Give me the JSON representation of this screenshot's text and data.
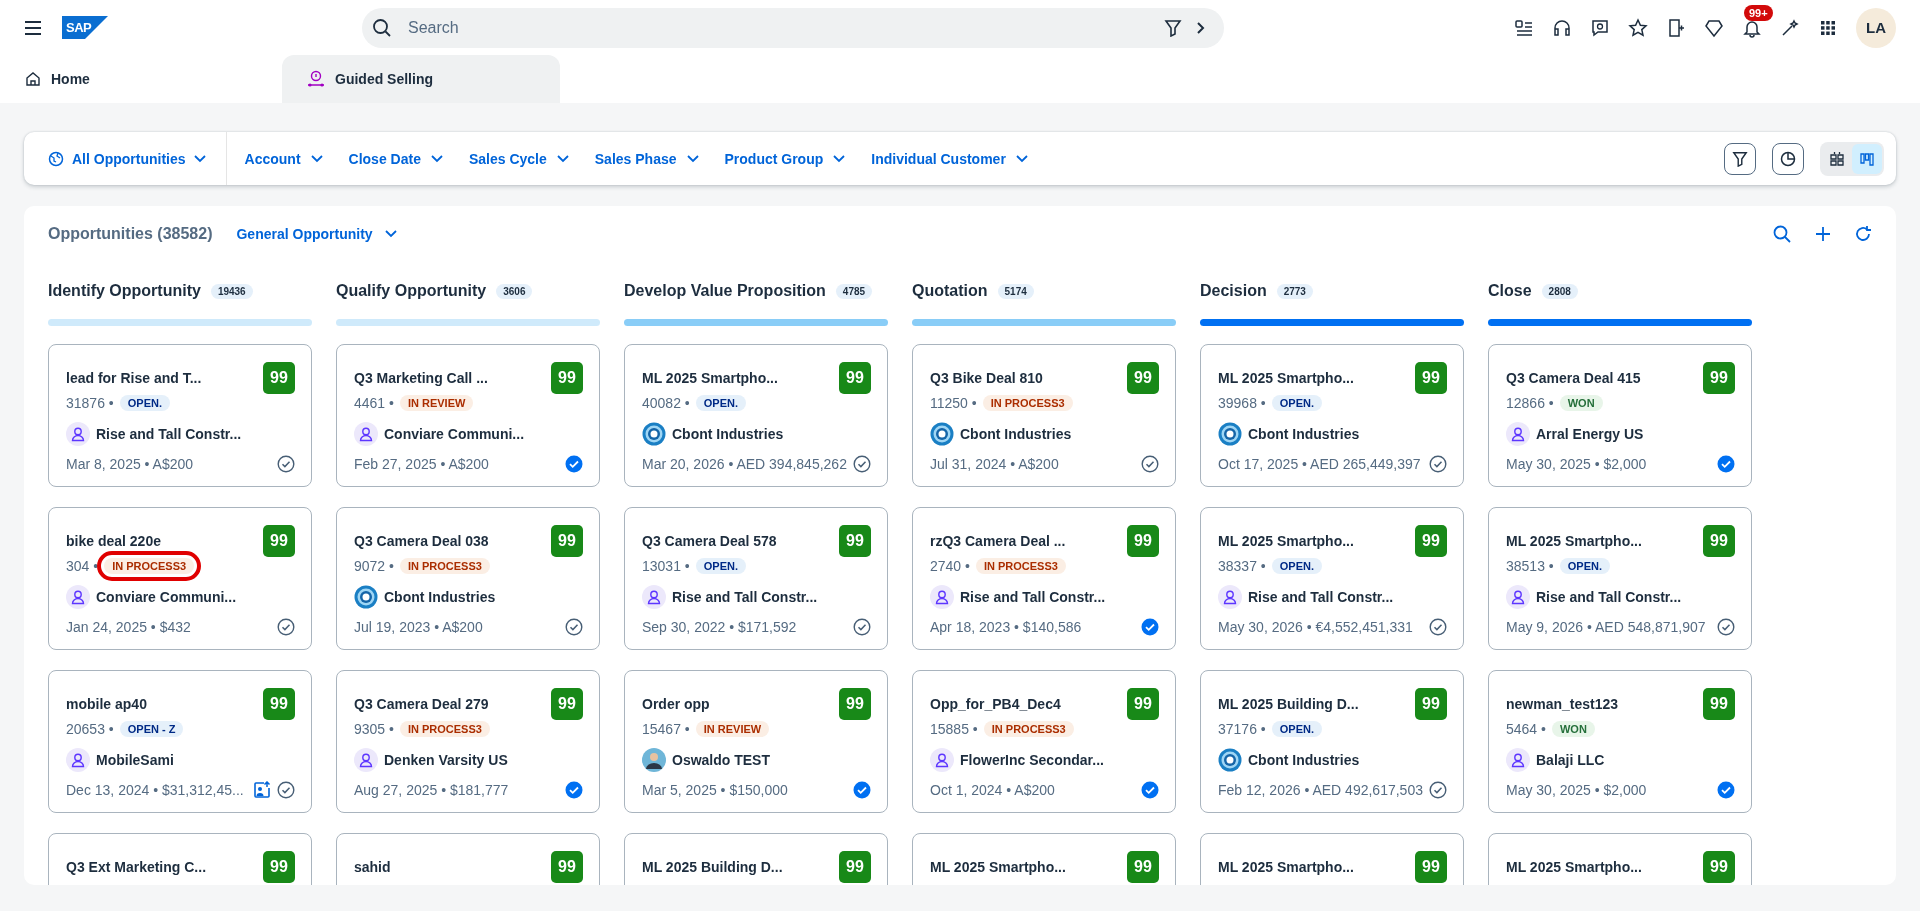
{
  "shell": {
    "logo_text": "SAP",
    "search_placeholder": "Search",
    "notification_count": "99+",
    "avatar_initials": "LA"
  },
  "tabs": [
    {
      "label": "Home",
      "selected": false
    },
    {
      "label": "Guided Selling",
      "selected": true
    }
  ],
  "filter_bar": {
    "variant": "All Opportunities",
    "filters": [
      "Account",
      "Close Date",
      "Sales Cycle",
      "Sales Phase",
      "Product Group",
      "Individual Customer"
    ],
    "view_toggle": [
      {
        "kind": "cards",
        "selected": false
      },
      {
        "kind": "kanban",
        "selected": true
      }
    ]
  },
  "board": {
    "title": "Opportunities (38582)",
    "type_selector": "General Opportunity",
    "columns": [
      {
        "name": "Identify Opportunity",
        "count": "19436",
        "color": "#cfeafb",
        "cards": [
          {
            "title": "lead for Rise and T...",
            "score": "99",
            "number": "31876 •",
            "status": {
              "label": "OPEN.",
              "kind": "info",
              "highlighted": false
            },
            "account": {
              "name": "Rise and Tall Constr...",
              "kind": "person"
            },
            "date_amount": "Mar 8, 2025 • A$200",
            "image_upload": false,
            "done": false
          },
          {
            "title": "bike deal 220e",
            "score": "99",
            "number": "304 •",
            "status": {
              "label": "IN PROCESS3",
              "kind": "warning",
              "highlighted": true
            },
            "account": {
              "name": "Conviare Communi...",
              "kind": "person"
            },
            "date_amount": "Jan 24, 2025 • $432",
            "image_upload": false,
            "done": false
          },
          {
            "title": "mobile ap40",
            "score": "99",
            "number": "20653 •",
            "status": {
              "label": "OPEN - Z",
              "kind": "info",
              "highlighted": false
            },
            "account": {
              "name": "MobileSami",
              "kind": "person"
            },
            "date_amount": "Dec 13, 2024 • $31,312,45...",
            "image_upload": true,
            "done": false
          },
          {
            "title": "Q3 Ext Marketing C...",
            "score": "99"
          }
        ]
      },
      {
        "name": "Qualify Opportunity",
        "count": "3606",
        "color": "#cfeafb",
        "cards": [
          {
            "title": "Q3 Marketing Call ...",
            "score": "99",
            "number": "4461 •",
            "status": {
              "label": "IN REVIEW",
              "kind": "warning",
              "highlighted": false
            },
            "account": {
              "name": "Conviare Communi...",
              "kind": "person"
            },
            "date_amount": "Feb 27, 2025 • A$200",
            "image_upload": false,
            "done": true
          },
          {
            "title": "Q3 Camera Deal 038",
            "score": "99",
            "number": "9072 •",
            "status": {
              "label": "IN PROCESS3",
              "kind": "warning",
              "highlighted": false
            },
            "account": {
              "name": "Cbont Industries",
              "kind": "logo"
            },
            "date_amount": "Jul 19, 2023 • A$200",
            "image_upload": false,
            "done": false
          },
          {
            "title": "Q3 Camera Deal 279",
            "score": "99",
            "number": "9305 •",
            "status": {
              "label": "IN PROCESS3",
              "kind": "warning",
              "highlighted": false
            },
            "account": {
              "name": "Denken Varsity US",
              "kind": "person"
            },
            "date_amount": "Aug 27, 2025 • $181,777",
            "image_upload": false,
            "done": true
          },
          {
            "title": "sahid",
            "score": "99"
          }
        ]
      },
      {
        "name": "Develop Value Proposition",
        "count": "4785",
        "color": "#89cdf7",
        "cards": [
          {
            "title": "ML 2025 Smartpho...",
            "score": "99",
            "number": "40082 •",
            "status": {
              "label": "OPEN.",
              "kind": "info",
              "highlighted": false
            },
            "account": {
              "name": "Cbont Industries",
              "kind": "logo"
            },
            "date_amount": "Mar 20, 2026 • AED 394,845,262",
            "image_upload": false,
            "done": false
          },
          {
            "title": "Q3 Camera Deal 578",
            "score": "99",
            "number": "13031 •",
            "status": {
              "label": "OPEN.",
              "kind": "info",
              "highlighted": false
            },
            "account": {
              "name": "Rise and Tall Constr...",
              "kind": "person"
            },
            "date_amount": "Sep 30, 2022 • $171,592",
            "image_upload": false,
            "done": false
          },
          {
            "title": "Order opp",
            "score": "99",
            "number": "15467 •",
            "status": {
              "label": "IN REVIEW",
              "kind": "warning",
              "highlighted": false
            },
            "account": {
              "name": "Oswaldo TEST",
              "kind": "photo"
            },
            "date_amount": "Mar 5, 2025 • $150,000",
            "image_upload": false,
            "done": true
          },
          {
            "title": "ML 2025 Building D...",
            "score": "99"
          }
        ]
      },
      {
        "name": "Quotation",
        "count": "5174",
        "color": "#89cdf7",
        "cards": [
          {
            "title": "Q3 Bike Deal 810",
            "score": "99",
            "number": "11250 •",
            "status": {
              "label": "IN PROCESS3",
              "kind": "warning",
              "highlighted": false
            },
            "account": {
              "name": "Cbont Industries",
              "kind": "logo"
            },
            "date_amount": "Jul 31, 2024 • A$200",
            "image_upload": false,
            "done": false
          },
          {
            "title": "rzQ3 Camera Deal ...",
            "score": "99",
            "number": "2740 •",
            "status": {
              "label": "IN PROCESS3",
              "kind": "warning",
              "highlighted": false
            },
            "account": {
              "name": "Rise and Tall Constr...",
              "kind": "person"
            },
            "date_amount": "Apr 18, 2023 • $140,586",
            "image_upload": false,
            "done": true
          },
          {
            "title": "Opp_for_PB4_Dec4",
            "score": "99",
            "number": "15885 •",
            "status": {
              "label": "IN PROCESS3",
              "kind": "warning",
              "highlighted": false
            },
            "account": {
              "name": "FlowerInc Secondar...",
              "kind": "person"
            },
            "date_amount": "Oct 1, 2024 • A$200",
            "image_upload": false,
            "done": true
          },
          {
            "title": "ML 2025 Smartpho...",
            "score": "99"
          }
        ]
      },
      {
        "name": "Decision",
        "count": "2773",
        "color": "#0070f2",
        "cards": [
          {
            "title": "ML 2025 Smartpho...",
            "score": "99",
            "number": "39968 •",
            "status": {
              "label": "OPEN.",
              "kind": "info",
              "highlighted": false
            },
            "account": {
              "name": "Cbont Industries",
              "kind": "logo"
            },
            "date_amount": "Oct 17, 2025 • AED 265,449,397",
            "image_upload": false,
            "done": false
          },
          {
            "title": "ML 2025 Smartpho...",
            "score": "99",
            "number": "38337 •",
            "status": {
              "label": "OPEN.",
              "kind": "info",
              "highlighted": false
            },
            "account": {
              "name": "Rise and Tall Constr...",
              "kind": "person"
            },
            "date_amount": "May 30, 2026 • €4,552,451,331",
            "image_upload": false,
            "done": false
          },
          {
            "title": "ML 2025 Building D...",
            "score": "99",
            "number": "37176 •",
            "status": {
              "label": "OPEN.",
              "kind": "info",
              "highlighted": false
            },
            "account": {
              "name": "Cbont Industries",
              "kind": "logo"
            },
            "date_amount": "Feb 12, 2026 • AED 492,617,503",
            "image_upload": false,
            "done": false
          },
          {
            "title": "ML 2025 Smartpho...",
            "score": "99"
          }
        ]
      },
      {
        "name": "Close",
        "count": "2808",
        "color": "#0070f2",
        "cards": [
          {
            "title": "Q3 Camera Deal 415",
            "score": "99",
            "number": "12866 •",
            "status": {
              "label": "WON",
              "kind": "success",
              "highlighted": false
            },
            "account": {
              "name": "Arral Energy US",
              "kind": "person"
            },
            "date_amount": "May 30, 2025 • $2,000",
            "image_upload": false,
            "done": true
          },
          {
            "title": "ML 2025 Smartpho...",
            "score": "99",
            "number": "38513 •",
            "status": {
              "label": "OPEN.",
              "kind": "info",
              "highlighted": false
            },
            "account": {
              "name": "Rise and Tall Constr...",
              "kind": "person"
            },
            "date_amount": "May 9, 2026 • AED 548,871,907",
            "image_upload": false,
            "done": false
          },
          {
            "title": "newman_test123",
            "score": "99",
            "number": "5464 •",
            "status": {
              "label": "WON",
              "kind": "success",
              "highlighted": false
            },
            "account": {
              "name": "Balaji LLC",
              "kind": "person"
            },
            "date_amount": "May 30, 2025 • $2,000",
            "image_upload": false,
            "done": true
          },
          {
            "title": "ML 2025 Smartpho...",
            "score": "99"
          }
        ]
      }
    ]
  }
}
